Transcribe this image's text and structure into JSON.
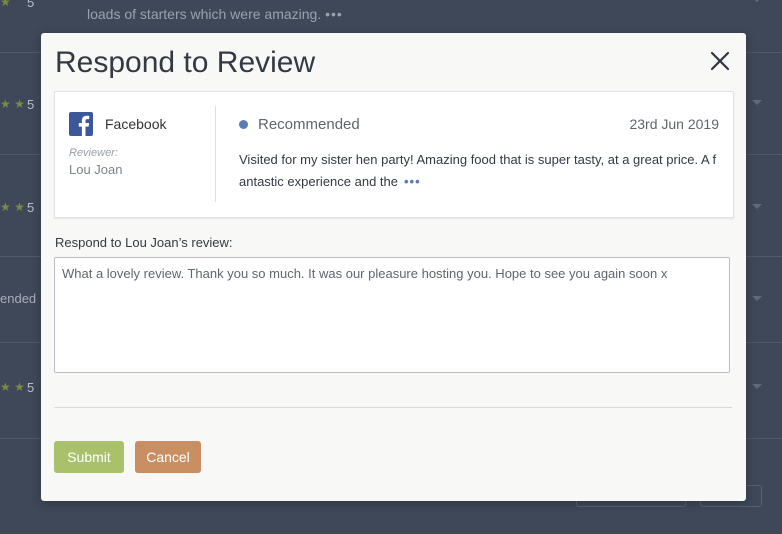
{
  "background": {
    "rows": [
      {
        "rating": "5",
        "text": "loads of starters which were amazing.",
        "more": "•••"
      },
      {
        "rating": "5"
      },
      {
        "rating": "5"
      },
      {
        "side_text": "ended"
      },
      {
        "rating": "5"
      }
    ]
  },
  "modal": {
    "title": "Respond to Review",
    "close_icon": "close-icon",
    "review": {
      "source": "Facebook",
      "source_icon": "facebook-icon",
      "reviewer_label": "Reviewer:",
      "reviewer_name": "Lou Joan",
      "recommendation": "Recommended",
      "date": "23rd Jun 2019",
      "text": "Visited for my sister hen party! Amazing food that is super tasty, at a great price. A fantastic experience and the",
      "more": "•••"
    },
    "respond_label": "Respond to Lou Joan’s review:",
    "response_value": "What a lovely review. Thank you so much. It was our pleasure hosting you. Hope to see you again soon x",
    "submit_label": "Submit",
    "cancel_label": "Cancel"
  },
  "colors": {
    "overlay": "#3e4859",
    "facebook": "#3b5998",
    "recommended_dot": "#5a7bb5",
    "submit": "#a9c16a",
    "cancel": "#c98e62"
  }
}
